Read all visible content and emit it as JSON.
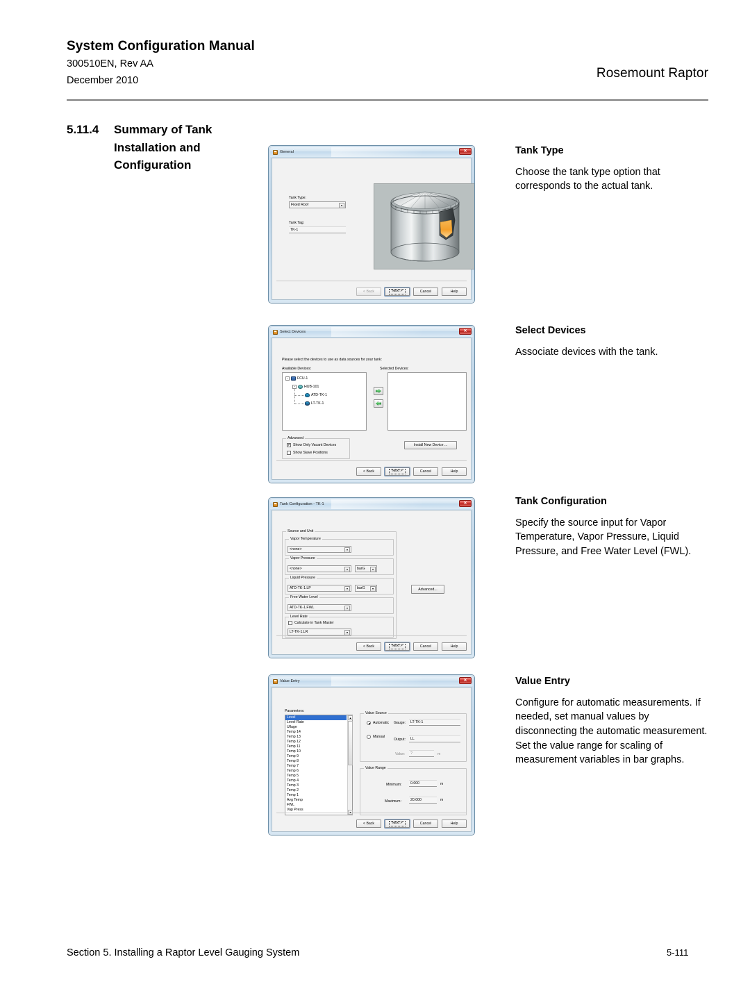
{
  "header": {
    "title": "System Configuration Manual",
    "doc_id": "300510EN, Rev AA",
    "date": "December 2010",
    "product": "Rosemount Raptor"
  },
  "section": {
    "number": "5.11.4",
    "title_line1": "Summary of Tank",
    "title_line2": "Installation and",
    "title_line3": "Configuration"
  },
  "descriptions": [
    {
      "heading": "Tank Type",
      "body": "Choose the tank type option that corresponds to the actual tank."
    },
    {
      "heading": "Select Devices",
      "body": "Associate devices with the tank."
    },
    {
      "heading": "Tank Configuration",
      "body": "Specify the source input for Vapor Temperature, Vapor Pressure, Liquid Pressure, and Free Water Level (FWL)."
    },
    {
      "heading": "Value Entry",
      "body": "Configure for automatic measurements. If needed, set manual values by disconnecting the automatic measurement. Set the value range for scaling of measurement variables in bar graphs."
    }
  ],
  "common_buttons": {
    "back": "< Back",
    "next": "Next >",
    "cancel": "Cancel",
    "help": "Help",
    "close_glyph": "✕"
  },
  "dialog_general": {
    "title": "General",
    "tank_type_label": "Tank Type:",
    "tank_type_value": "Fixed Roof",
    "tank_tag_label": "Tank Tag:",
    "tank_tag_value": "TK-1"
  },
  "dialog_select_devices": {
    "title": "Select Devices",
    "instruction": "Please select the devices to use as data sources for your tank:",
    "available_label": "Available Devices:",
    "selected_label": "Selected Devices:",
    "tree": [
      {
        "label": "FCU-1",
        "icon": "fcu-icon",
        "depth": 0,
        "expander": "-"
      },
      {
        "label": "HUB-101",
        "icon": "hub-icon",
        "depth": 1,
        "expander": "-"
      },
      {
        "label": "ATD-TK-1",
        "icon": "atd-icon",
        "depth": 2,
        "expander": ""
      },
      {
        "label": "LT-TK-1",
        "icon": "lt-icon",
        "depth": 2,
        "expander": ""
      }
    ],
    "advanced_label": "Advanced",
    "show_vacant_label": "Show Only Vacant Devices",
    "show_vacant_checked": "✔",
    "show_slave_label": "Show Slave Positions",
    "install_button": "Install New Device ...",
    "move_right_icon": "arrow-right-icon",
    "move_left_icon": "arrow-left-icon"
  },
  "dialog_tank_configuration": {
    "title": "Tank Configuration - TK-1",
    "group_label": "Source and Unit",
    "fields": [
      {
        "label": "Vapor Temperature",
        "value": "<none>",
        "unit": ""
      },
      {
        "label": "Vapor Pressure",
        "value": "<none>",
        "unit": "barG"
      },
      {
        "label": "Liquid Pressure",
        "value": "ATD-TK-1.LP",
        "unit": "barG"
      },
      {
        "label": "Free Water Level",
        "value": "ATD-TK-1.FWL",
        "unit": ""
      }
    ],
    "level_rate_label": "Level Rate",
    "calculate_label": "Calculate in Tank Master",
    "level_rate_value": "LT-TK-1.LR",
    "advanced_button": "Advanced..."
  },
  "dialog_value_entry": {
    "title": "Value Entry",
    "parameters_label": "Parameters:",
    "parameters": [
      "Level",
      "Level Rate",
      "Ullage",
      "Temp 14",
      "Temp 13",
      "Temp 12",
      "Temp 11",
      "Temp 10",
      "Temp 9",
      "Temp 8",
      "Temp 7",
      "Temp 6",
      "Temp 5",
      "Temp 4",
      "Temp 3",
      "Temp 2",
      "Temp 1",
      "Avg Temp",
      "FWL",
      "Vap Press"
    ],
    "selected_parameter": "Level",
    "value_source_label": "Value Source",
    "automatic_label": "Automatic",
    "manual_label": "Manual",
    "gauge_label": "Gauge:",
    "gauge_value": "LT-TK-1",
    "output_label": "Output:",
    "output_value": "LL",
    "value_label": "Value:",
    "value_value": "?",
    "value_unit": "m",
    "value_range_label": "Value Range",
    "minimum_label": "Minimum:",
    "minimum_value": "0.000",
    "minimum_unit": "m",
    "maximum_label": "Maximum:",
    "maximum_value": "20.000",
    "maximum_unit": "m"
  },
  "footer": {
    "text": "Section 5. Installing a Raptor Level Gauging System",
    "page": "5-111"
  }
}
